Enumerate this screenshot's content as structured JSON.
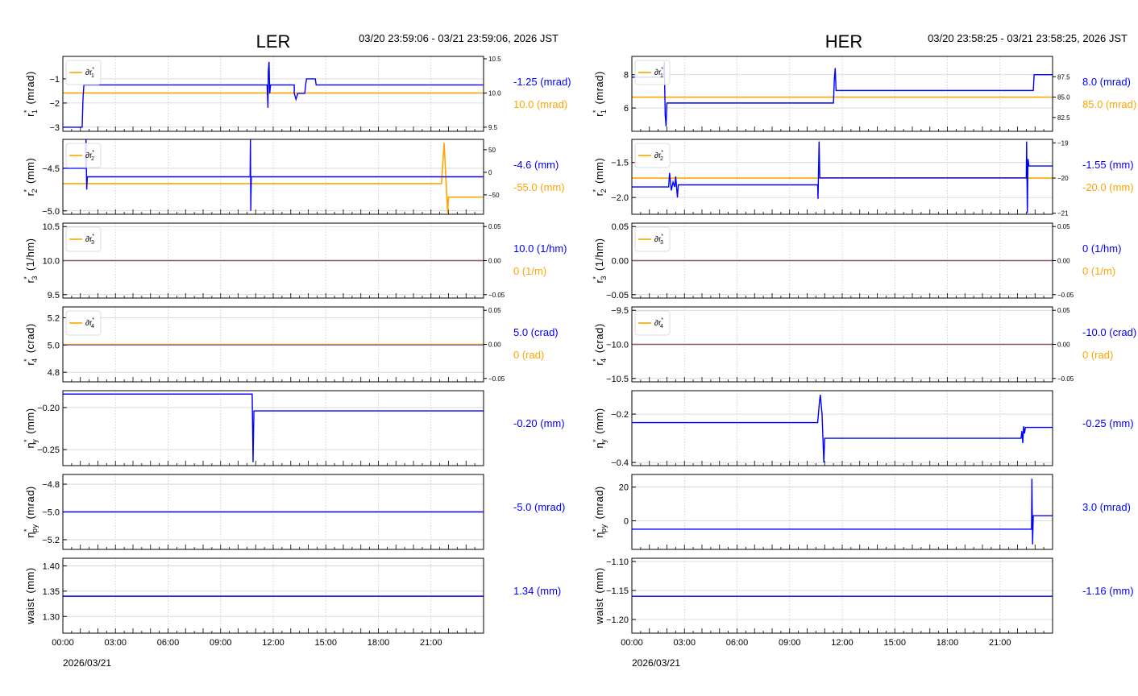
{
  "chart_data": [
    {
      "type": "line",
      "title": "LER",
      "time_range": "03/20 23:59:06 - 03/21 23:59:06, 2026 JST",
      "xticks": [
        "00:00",
        "03:00",
        "06:00",
        "09:00",
        "12:00",
        "15:00",
        "18:00",
        "21:00"
      ],
      "xdate": "2026/03/21",
      "xlim_hours": [
        0,
        24
      ],
      "panels": [
        {
          "ylabel": {
            "base": "r",
            "sup": "*",
            "sub": "1",
            "unit": "(mrad)"
          },
          "ylim": [
            -3.17,
            -0.07
          ],
          "yticks": [
            -1,
            -2,
            -3
          ],
          "rlim": [
            9.44,
            10.535
          ],
          "rticks": [
            "10.5",
            "10.0",
            "9.5"
          ],
          "rtickvals": [
            10.5,
            10.0,
            9.5
          ],
          "legend": {
            "base": "∂r",
            "sup": "*",
            "sub": "1"
          },
          "blue": [
            [
              0,
              -3
            ],
            [
              1.1,
              -3
            ],
            [
              1.15,
              -1.8
            ],
            [
              1.2,
              -1.25
            ],
            [
              11.65,
              -1.25
            ],
            [
              11.7,
              -2.2
            ],
            [
              11.72,
              -0.7
            ],
            [
              11.76,
              -0.3
            ],
            [
              11.8,
              -1.6
            ],
            [
              11.85,
              -1.25
            ],
            [
              13.2,
              -1.25
            ],
            [
              13.2,
              -1.6
            ],
            [
              13.3,
              -1.85
            ],
            [
              13.4,
              -1.6
            ],
            [
              13.8,
              -1.6
            ],
            [
              13.85,
              -1.25
            ],
            [
              13.9,
              -1.0
            ],
            [
              14.4,
              -1.0
            ],
            [
              14.45,
              -1.25
            ],
            [
              24,
              -1.25
            ]
          ],
          "orange": [
            [
              0,
              10.0
            ],
            [
              24,
              10.0
            ]
          ],
          "values": [
            {
              "text": "-1.25 (mrad)",
              "color": "#0000ff"
            },
            {
              "text": "10.0 (mrad)",
              "color": "#ffa500"
            }
          ]
        },
        {
          "ylabel": {
            "base": "r",
            "sup": "*",
            "sub": "2",
            "unit": "(mm)"
          },
          "ylim": [
            -5.04,
            -4.16
          ],
          "yticks": [
            -4.5,
            -5.0
          ],
          "ytickfmt": 1,
          "rlim": [
            -93,
            73
          ],
          "rticks": [
            "50",
            "0",
            "−50"
          ],
          "rtickvals": [
            50,
            0,
            -50
          ],
          "legend": {
            "base": "∂r",
            "sup": "*",
            "sub": "2"
          },
          "blue": [
            [
              0,
              -4.5
            ],
            [
              1.3,
              -4.5
            ],
            [
              1.32,
              -4.12
            ],
            [
              1.36,
              -4.75
            ],
            [
              1.4,
              -4.6
            ],
            [
              10.68,
              -4.6
            ],
            [
              10.7,
              -4.13
            ],
            [
              10.72,
              -5.0
            ],
            [
              10.75,
              -4.6
            ],
            [
              24,
              -4.6
            ]
          ],
          "orange": [
            [
              0,
              -25
            ],
            [
              21.6,
              -25
            ],
            [
              21.75,
              65
            ],
            [
              21.95,
              -90
            ],
            [
              22.0,
              -55
            ],
            [
              24,
              -55
            ]
          ],
          "values": [
            {
              "text": "-4.6 (mm)",
              "color": "#0000ff"
            },
            {
              "text": "-55.0 (mm)",
              "color": "#ffa500"
            }
          ]
        },
        {
          "ylabel": {
            "base": "r",
            "sup": "*",
            "sub": "3",
            "unit": "(1/hm)"
          },
          "ylim": [
            9.45,
            10.55
          ],
          "yticks": [
            10.5,
            10.0,
            9.5
          ],
          "ytickfmt": 1,
          "rlim": [
            -0.055,
            0.055
          ],
          "rticks": [
            "0.05",
            "0.00",
            "−0.05"
          ],
          "rtickvals": [
            0.05,
            0,
            -0.05
          ],
          "legend": {
            "base": "∂r",
            "sup": "*",
            "sub": "3"
          },
          "blue": [
            [
              0,
              10.0
            ],
            [
              24,
              10.0
            ]
          ],
          "orange": [
            [
              0,
              0
            ],
            [
              24,
              0
            ]
          ],
          "values": [
            {
              "text": "10.0 (1/hm)",
              "color": "#0000ff"
            },
            {
              "text": "0 (1/m)",
              "color": "#ffa500"
            }
          ]
        },
        {
          "ylabel": {
            "base": "r",
            "sup": "*",
            "sub": "4",
            "unit": "(crad)"
          },
          "ylim": [
            4.73,
            5.28
          ],
          "yticks": [
            5.2,
            5.0,
            4.8
          ],
          "ytickfmt": 1,
          "rlim": [
            -0.055,
            0.055
          ],
          "rticks": [
            "0.05",
            "0.00",
            "−0.05"
          ],
          "rtickvals": [
            0.05,
            0,
            -0.05
          ],
          "legend": {
            "base": "∂r",
            "sup": "*",
            "sub": "4"
          },
          "blue": [
            [
              0,
              5.0
            ],
            [
              24,
              5.0
            ]
          ],
          "orange": [
            [
              0,
              0
            ],
            [
              24,
              0
            ]
          ],
          "values": [
            {
              "text": "5.0 (crad)",
              "color": "#0000ff"
            },
            {
              "text": "0 (rad)",
              "color": "#ffa500"
            }
          ]
        },
        {
          "ylabel": {
            "base": "η",
            "sup": "*",
            "sub": "y",
            "unit": "(mm)"
          },
          "ylim": [
            -0.269,
            -0.18
          ],
          "yticks": [
            -0.2,
            -0.25
          ],
          "ytickfmt": 2,
          "blue": [
            [
              0,
              -0.184
            ],
            [
              10.8,
              -0.184
            ],
            [
              10.85,
              -0.265
            ],
            [
              10.9,
              -0.204
            ],
            [
              24,
              -0.204
            ]
          ],
          "values": [
            {
              "text": "-0.20 (mm)",
              "color": "#0000ff"
            }
          ]
        },
        {
          "ylabel": {
            "base": "η",
            "sup": "*",
            "sub": "py",
            "unit": "(mrad)"
          },
          "ylim": [
            -5.27,
            -4.73
          ],
          "yticks": [
            -4.8,
            -5.0,
            -5.2
          ],
          "ytickfmt": 1,
          "blue": [
            [
              0,
              -5.0
            ],
            [
              24,
              -5.0
            ]
          ],
          "values": [
            {
              "text": "-5.0 (mrad)",
              "color": "#0000ff"
            }
          ]
        },
        {
          "ylabel": {
            "base": "waist",
            "unit": "(mm)"
          },
          "ylim": [
            1.267,
            1.415
          ],
          "yticks": [
            1.4,
            1.35,
            1.3
          ],
          "ytickfmt": 2,
          "blue": [
            [
              0,
              1.34
            ],
            [
              24,
              1.34
            ]
          ],
          "values": [
            {
              "text": "1.34 (mm)",
              "color": "#0000ff"
            }
          ]
        }
      ]
    },
    {
      "type": "line",
      "title": "HER",
      "time_range": "03/20 23:58:25 - 03/21 23:58:25, 2026 JST",
      "xticks": [
        "00:00",
        "03:00",
        "06:00",
        "09:00",
        "12:00",
        "15:00",
        "18:00",
        "21:00"
      ],
      "xdate": "2026/03/21",
      "xlim_hours": [
        0,
        24
      ],
      "panels": [
        {
          "ylabel": {
            "base": "r",
            "sup": "*",
            "sub": "1",
            "unit": "(mrad)"
          },
          "ylim": [
            4.6,
            9.1
          ],
          "yticks": [
            8,
            6
          ],
          "rlim": [
            80.8,
            90.0
          ],
          "rticks": [
            "87.5",
            "85.0",
            "82.5"
          ],
          "rtickvals": [
            87.5,
            85.0,
            82.5
          ],
          "legend": {
            "base": "∂r",
            "sup": "*",
            "sub": "1"
          },
          "blue": [
            [
              0,
              7.85
            ],
            [
              1.8,
              7.85
            ],
            [
              1.85,
              8.8
            ],
            [
              1.9,
              5.6
            ],
            [
              1.95,
              4.9
            ],
            [
              2.0,
              6.3
            ],
            [
              11.5,
              6.3
            ],
            [
              11.55,
              7.7
            ],
            [
              11.6,
              8.4
            ],
            [
              11.65,
              7.05
            ],
            [
              22.9,
              7.05
            ],
            [
              22.95,
              8.0
            ],
            [
              24,
              8.0
            ]
          ],
          "orange": [
            [
              0,
              85.0
            ],
            [
              24,
              85.0
            ]
          ],
          "values": [
            {
              "text": "8.0 (mrad)",
              "color": "#0000ff"
            },
            {
              "text": "85.0 (mrad)",
              "color": "#ffa500"
            }
          ]
        },
        {
          "ylabel": {
            "base": "r",
            "sup": "*",
            "sub": "2",
            "unit": "(mm)"
          },
          "ylim": [
            -2.24,
            -1.17
          ],
          "yticks": [
            -1.5,
            -2.0
          ],
          "ytickfmt": 1,
          "rlim": [
            -21.03,
            -18.9
          ],
          "rticks": [
            "−19",
            "−20",
            "−21"
          ],
          "rtickvals": [
            -19,
            -20,
            -21
          ],
          "legend": {
            "base": "∂r",
            "sup": "*",
            "sub": "2"
          },
          "blue": [
            [
              0,
              -1.85
            ],
            [
              2.1,
              -1.85
            ],
            [
              2.15,
              -1.65
            ],
            [
              2.25,
              -1.9
            ],
            [
              2.35,
              -1.78
            ],
            [
              2.45,
              -1.85
            ],
            [
              2.5,
              -1.7
            ],
            [
              2.6,
              -2.0
            ],
            [
              2.65,
              -1.82
            ],
            [
              10.6,
              -1.82
            ],
            [
              10.62,
              -2.02
            ],
            [
              10.68,
              -1.2
            ],
            [
              10.72,
              -1.72
            ],
            [
              22.5,
              -1.72
            ],
            [
              22.52,
              -1.2
            ],
            [
              22.56,
              -2.22
            ],
            [
              22.6,
              -1.45
            ],
            [
              22.65,
              -1.55
            ],
            [
              24,
              -1.55
            ]
          ],
          "orange": [
            [
              0,
              -20
            ],
            [
              24,
              -20
            ]
          ],
          "values": [
            {
              "text": "-1.55 (mm)",
              "color": "#0000ff"
            },
            {
              "text": "-20.0 (mm)",
              "color": "#ffa500"
            }
          ]
        },
        {
          "ylabel": {
            "base": "r",
            "sup": "*",
            "sub": "3",
            "unit": "(1/hm)"
          },
          "ylim": [
            -0.055,
            0.055
          ],
          "yticks": [
            0.05,
            0.0,
            -0.05
          ],
          "ytickfmt": 2,
          "rlim": [
            -0.055,
            0.055
          ],
          "rticks": [
            "0.05",
            "0.00",
            "−0.05"
          ],
          "rtickvals": [
            0.05,
            0,
            -0.05
          ],
          "legend": {
            "base": "∂r",
            "sup": "*",
            "sub": "3"
          },
          "blue": [
            [
              0,
              0
            ],
            [
              24,
              0
            ]
          ],
          "orange": [
            [
              0,
              0
            ],
            [
              24,
              0
            ]
          ],
          "values": [
            {
              "text": "0 (1/hm)",
              "color": "#0000ff"
            },
            {
              "text": "0 (1/m)",
              "color": "#ffa500"
            }
          ]
        },
        {
          "ylabel": {
            "base": "r",
            "sup": "*",
            "sub": "4",
            "unit": "(crad)"
          },
          "ylim": [
            -10.55,
            -9.45
          ],
          "yticks": [
            -9.5,
            -10.0,
            -10.5
          ],
          "ytickfmt": 1,
          "rlim": [
            -0.055,
            0.055
          ],
          "rticks": [
            "0.05",
            "0.00",
            "−0.05"
          ],
          "rtickvals": [
            0.05,
            0,
            -0.05
          ],
          "legend": {
            "base": "∂r",
            "sup": "*",
            "sub": "4"
          },
          "blue": [
            [
              0,
              -10.0
            ],
            [
              24,
              -10.0
            ]
          ],
          "orange": [
            [
              0,
              0
            ],
            [
              24,
              0
            ]
          ],
          "values": [
            {
              "text": "-10.0 (crad)",
              "color": "#0000ff"
            },
            {
              "text": "0 (rad)",
              "color": "#ffa500"
            }
          ]
        },
        {
          "ylabel": {
            "base": "η",
            "sup": "*",
            "sub": "y",
            "unit": "(mm)"
          },
          "ylim": [
            -0.413,
            -0.103
          ],
          "yticks": [
            -0.2,
            -0.4
          ],
          "ytickfmt": 1,
          "blue": [
            [
              0,
              -0.235
            ],
            [
              10.6,
              -0.235
            ],
            [
              10.7,
              -0.15
            ],
            [
              10.75,
              -0.12
            ],
            [
              10.85,
              -0.2
            ],
            [
              10.95,
              -0.4
            ],
            [
              11.0,
              -0.3
            ],
            [
              22.2,
              -0.3
            ],
            [
              22.25,
              -0.27
            ],
            [
              22.3,
              -0.32
            ],
            [
              22.35,
              -0.25
            ],
            [
              22.4,
              -0.28
            ],
            [
              22.45,
              -0.255
            ],
            [
              24,
              -0.255
            ]
          ],
          "values": [
            {
              "text": "-0.25 (mm)",
              "color": "#0000ff"
            }
          ]
        },
        {
          "ylabel": {
            "base": "η",
            "sup": "*",
            "sub": "py",
            "unit": "(mrad)"
          },
          "ylim": [
            -17,
            27.5
          ],
          "yticks": [
            20,
            0
          ],
          "ytickfmt": 0,
          "blue": [
            [
              0,
              -5
            ],
            [
              22.8,
              -5
            ],
            [
              22.82,
              25
            ],
            [
              22.86,
              -14
            ],
            [
              22.9,
              3
            ],
            [
              24,
              3
            ]
          ],
          "values": [
            {
              "text": "3.0 (mrad)",
              "color": "#0000ff"
            }
          ]
        },
        {
          "ylabel": {
            "base": "waist",
            "unit": "(mm)"
          },
          "ylim": [
            -1.2236,
            -1.0944
          ],
          "yticks": [
            -1.1,
            -1.15,
            -1.2
          ],
          "ytickfmt": 2,
          "blue": [
            [
              0,
              -1.16
            ],
            [
              24,
              -1.16
            ]
          ],
          "values": [
            {
              "text": "-1.16 (mm)",
              "color": "#0000ff"
            }
          ]
        }
      ]
    }
  ]
}
